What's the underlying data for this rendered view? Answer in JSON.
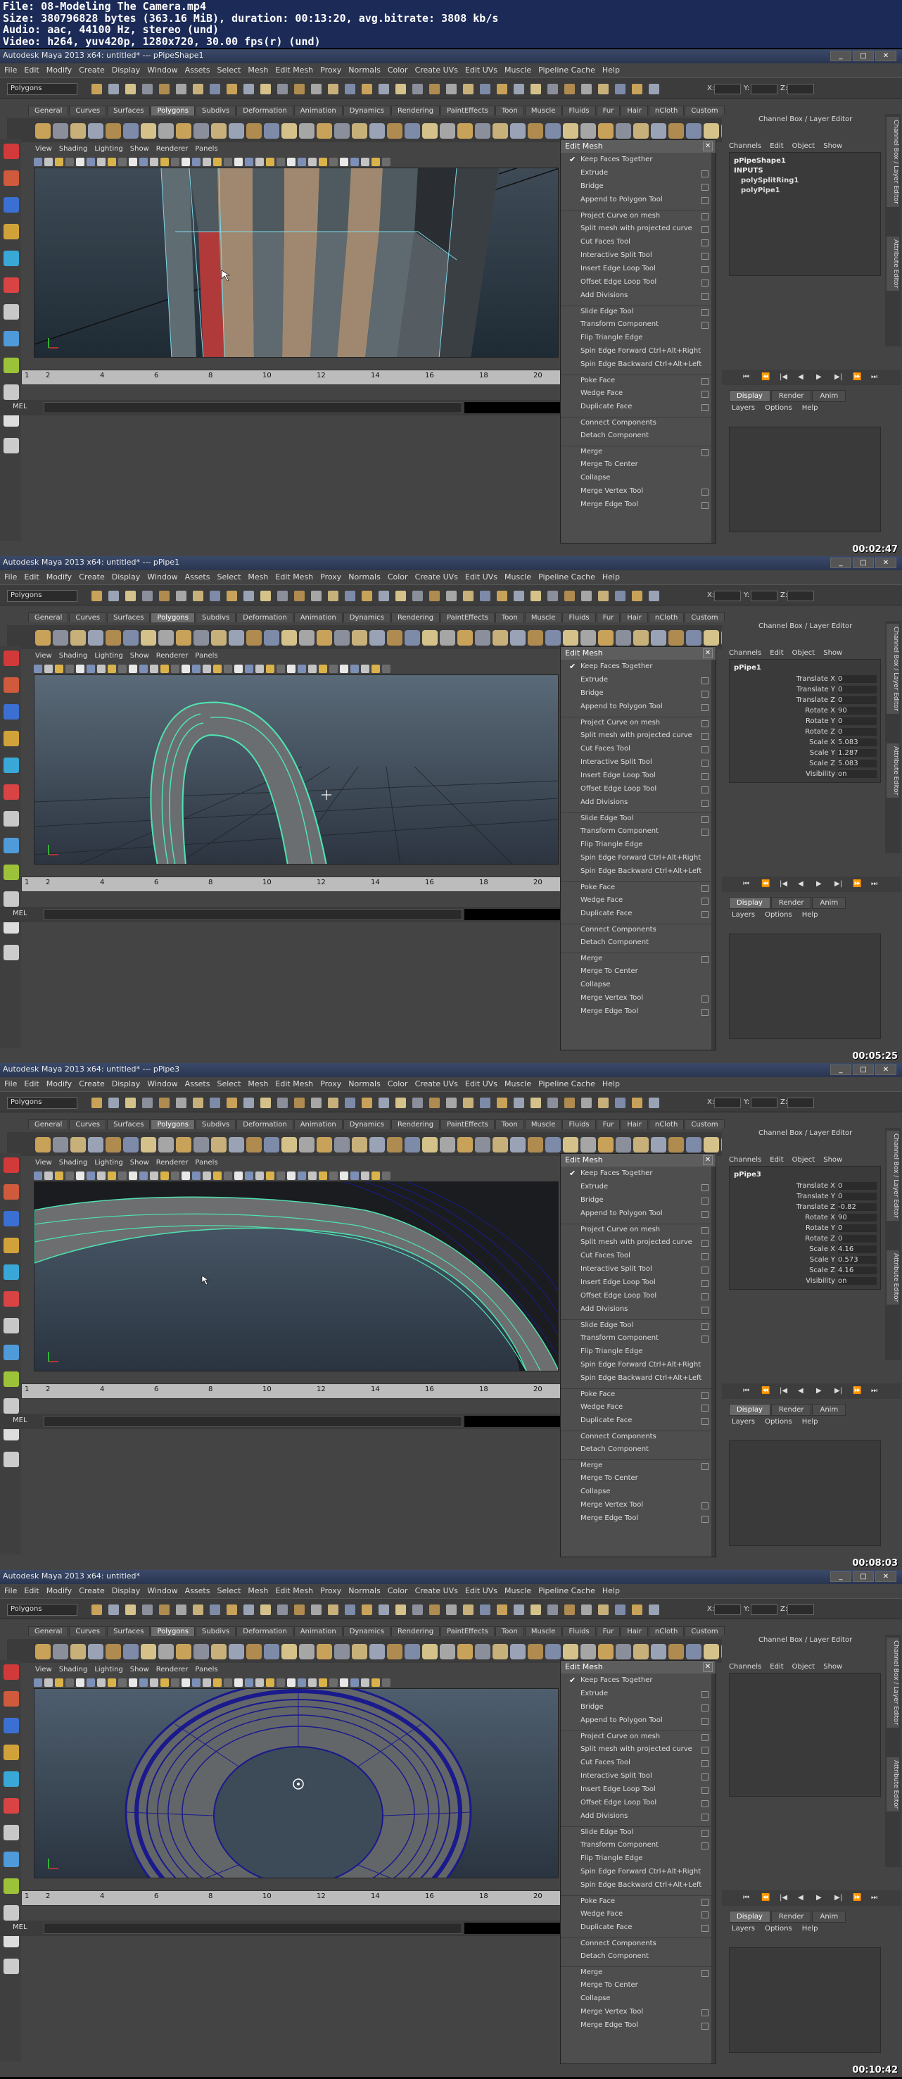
{
  "header": {
    "line1": "File: 08-Modeling The Camera.mp4",
    "line2": "Size: 380796828 bytes (363.16 MiB), duration: 00:13:20, avg.bitrate: 3808 kb/s",
    "line3": "Audio: aac, 44100 Hz, stereo (und)",
    "line4": "Video: h264, yuv420p, 1280x720, 30.00 fps(r) (und)"
  },
  "app": {
    "menus": [
      "File",
      "Edit",
      "Modify",
      "Create",
      "Display",
      "Window",
      "Assets",
      "Select",
      "Mesh",
      "Edit Mesh",
      "Proxy",
      "Normals",
      "Color",
      "Create UVs",
      "Edit UVs",
      "Muscle",
      "Pipeline Cache",
      "Help"
    ],
    "mode": "Polygons",
    "field_labels": [
      "X:",
      "Y:",
      "Z:"
    ],
    "shelf_tabs": [
      "General",
      "Curves",
      "Surfaces",
      "Polygons",
      "Subdivs",
      "Deformation",
      "Animation",
      "Dynamics",
      "Rendering",
      "PaintEffects",
      "Toon",
      "Muscle",
      "Fluids",
      "Fur",
      "Hair",
      "nCloth",
      "Custom"
    ],
    "active_shelf": "Polygons",
    "panel_menus": [
      "View",
      "Shading",
      "Lighting",
      "Show",
      "Renderer",
      "Panels"
    ],
    "timeline_ticks": [
      "2",
      "4",
      "6",
      "8",
      "10",
      "12",
      "14",
      "16",
      "18",
      "20"
    ],
    "timeline_start": "1",
    "mel_label": "MEL",
    "edit_mesh_title": "Edit Mesh",
    "edit_mesh_items": [
      {
        "label": "Keep Faces Together",
        "checked": true,
        "box": false,
        "sep": false
      },
      {
        "label": "Extrude",
        "checked": false,
        "box": true,
        "sep": false
      },
      {
        "label": "Bridge",
        "checked": false,
        "box": true,
        "sep": false
      },
      {
        "label": "Append to Polygon Tool",
        "checked": false,
        "box": true,
        "sep": false
      },
      {
        "label": "Project Curve on mesh",
        "checked": false,
        "box": true,
        "sep": true
      },
      {
        "label": "Split mesh with projected curve",
        "checked": false,
        "box": true,
        "sep": false
      },
      {
        "label": "Cut Faces Tool",
        "checked": false,
        "box": true,
        "sep": false
      },
      {
        "label": "Interactive Split Tool",
        "checked": false,
        "box": true,
        "sep": false
      },
      {
        "label": "Insert Edge Loop Tool",
        "checked": false,
        "box": true,
        "sep": false
      },
      {
        "label": "Offset Edge Loop Tool",
        "checked": false,
        "box": true,
        "sep": false
      },
      {
        "label": "Add Divisions",
        "checked": false,
        "box": true,
        "sep": false
      },
      {
        "label": "Slide Edge Tool",
        "checked": false,
        "box": true,
        "sep": true
      },
      {
        "label": "Transform Component",
        "checked": false,
        "box": true,
        "sep": false
      },
      {
        "label": "Flip Triangle Edge",
        "checked": false,
        "box": false,
        "sep": false
      },
      {
        "label": "Spin Edge Forward  Ctrl+Alt+Right",
        "checked": false,
        "box": false,
        "sep": false
      },
      {
        "label": "Spin Edge Backward  Ctrl+Alt+Left",
        "checked": false,
        "box": false,
        "sep": false
      },
      {
        "label": "Poke Face",
        "checked": false,
        "box": true,
        "sep": true
      },
      {
        "label": "Wedge Face",
        "checked": false,
        "box": true,
        "sep": false
      },
      {
        "label": "Duplicate Face",
        "checked": false,
        "box": true,
        "sep": false
      },
      {
        "label": "Connect Components",
        "checked": false,
        "box": false,
        "sep": true
      },
      {
        "label": "Detach Component",
        "checked": false,
        "box": false,
        "sep": false
      },
      {
        "label": "Merge",
        "checked": false,
        "box": true,
        "sep": true
      },
      {
        "label": "Merge To Center",
        "checked": false,
        "box": false,
        "sep": false
      },
      {
        "label": "Collapse",
        "checked": false,
        "box": false,
        "sep": false
      },
      {
        "label": "Merge Vertex Tool",
        "checked": false,
        "box": true,
        "sep": false
      },
      {
        "label": "Merge Edge Tool",
        "checked": false,
        "box": true,
        "sep": false
      }
    ],
    "channel_title": "Channel Box / Layer Editor",
    "channel_menus": [
      "Channels",
      "Edit",
      "Object",
      "Show"
    ],
    "layer_tabs": [
      "Display",
      "Render",
      "Anim"
    ],
    "layer_menus": [
      "Layers",
      "Options",
      "Help"
    ],
    "side_tabs": [
      "Channel Box / Layer Editor",
      "Attribute Editor"
    ]
  },
  "frames": [
    {
      "title": "Autodesk Maya 2013 x64: untitled*  ---  pPipeShape1",
      "timecode": "00:02:47",
      "scene": "pipe-closeup",
      "channel": {
        "type": "tree",
        "lines": [
          {
            "text": "pPipeShape1",
            "indent": false
          },
          {
            "text": "INPUTS",
            "indent": false
          },
          {
            "text": "polySplitRing1",
            "indent": true
          },
          {
            "text": "polyPipe1",
            "indent": true
          }
        ]
      }
    },
    {
      "title": "Autodesk Maya 2013 x64: untitled*  ---  pPipe1",
      "timecode": "00:05:25",
      "scene": "arch",
      "channel": {
        "type": "attrs",
        "node": "pPipe1",
        "attrs": [
          {
            "name": "Translate X",
            "value": "0"
          },
          {
            "name": "Translate Y",
            "value": "0"
          },
          {
            "name": "Translate Z",
            "value": "0"
          },
          {
            "name": "Rotate X",
            "value": "90"
          },
          {
            "name": "Rotate Y",
            "value": "0"
          },
          {
            "name": "Rotate Z",
            "value": "0"
          },
          {
            "name": "Scale X",
            "value": "5.083"
          },
          {
            "name": "Scale Y",
            "value": "1.287"
          },
          {
            "name": "Scale Z",
            "value": "5.083"
          },
          {
            "name": "Visibility",
            "value": "on"
          }
        ]
      }
    },
    {
      "title": "Autodesk Maya 2013 x64: untitled*  ---  pPipe3",
      "timecode": "00:08:03",
      "scene": "ring-closeup",
      "channel": {
        "type": "attrs",
        "node": "pPipe3",
        "attrs": [
          {
            "name": "Translate X",
            "value": "0"
          },
          {
            "name": "Translate Y",
            "value": "0"
          },
          {
            "name": "Translate Z",
            "value": "-0.82"
          },
          {
            "name": "Rotate X",
            "value": "90"
          },
          {
            "name": "Rotate Y",
            "value": "0"
          },
          {
            "name": "Rotate Z",
            "value": "0"
          },
          {
            "name": "Scale X",
            "value": "4.16"
          },
          {
            "name": "Scale Y",
            "value": "0.573"
          },
          {
            "name": "Scale Z",
            "value": "4.16"
          },
          {
            "name": "Visibility",
            "value": "on"
          }
        ]
      }
    },
    {
      "title": "Autodesk Maya 2013 x64: untitled*",
      "timecode": "00:10:42",
      "scene": "torus",
      "channel": {
        "type": "empty"
      }
    }
  ],
  "colors": {
    "header_bg": "#1b2a57",
    "ui_bg": "#444444",
    "selection": "#4fe3b0",
    "wire": "#1a1a8c",
    "face_red": "#b03a3a",
    "face_tan": "#a08870"
  }
}
